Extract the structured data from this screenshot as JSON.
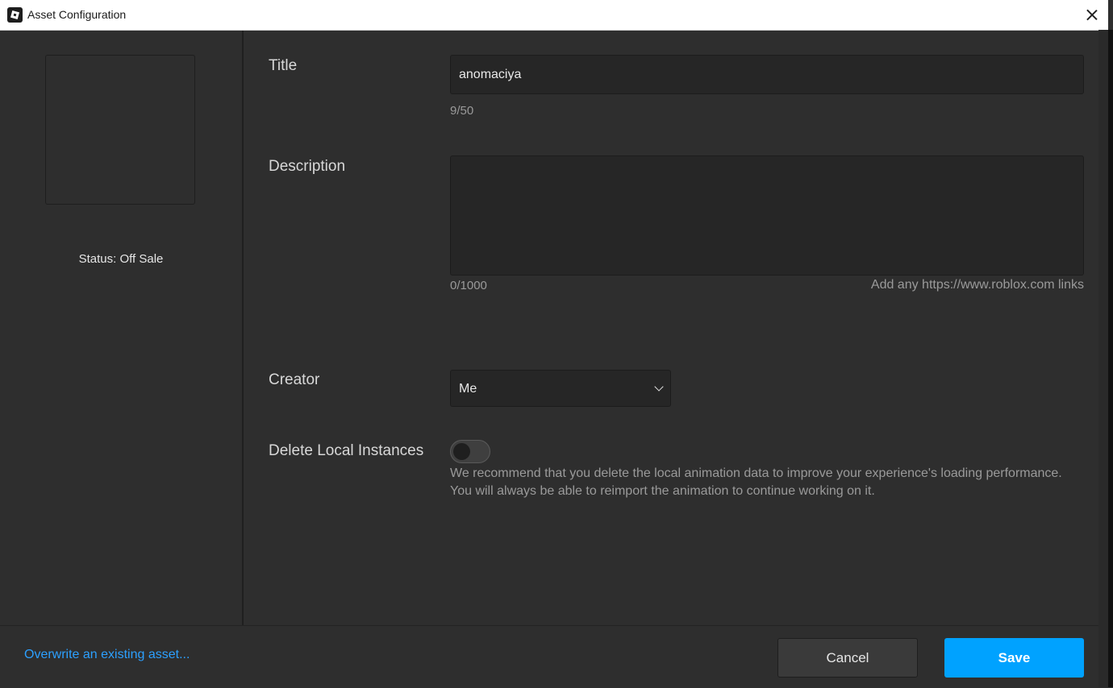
{
  "window": {
    "title": "Asset Configuration",
    "close_icon": "close-icon"
  },
  "sidebar": {
    "status": "Status: Off Sale"
  },
  "form": {
    "title_label": "Title",
    "title_value": "anomaciya",
    "title_counter": "9/50",
    "description_label": "Description",
    "description_value": "",
    "description_counter": "0/1000",
    "description_hint": "Add any https://www.roblox.com links",
    "creator_label": "Creator",
    "creator_selected": "Me",
    "delete_label": "Delete Local Instances",
    "delete_enabled": false,
    "delete_help": "We recommend that you delete the local animation data to improve your experience's loading performance. You will always be able to reimport the animation to continue working on it."
  },
  "footer": {
    "overwrite_link": "Overwrite an existing asset...",
    "cancel_label": "Cancel",
    "save_label": "Save"
  },
  "colors": {
    "accent": "#00a2ff",
    "link": "#2ca0ff",
    "background": "#2e2e2e"
  }
}
